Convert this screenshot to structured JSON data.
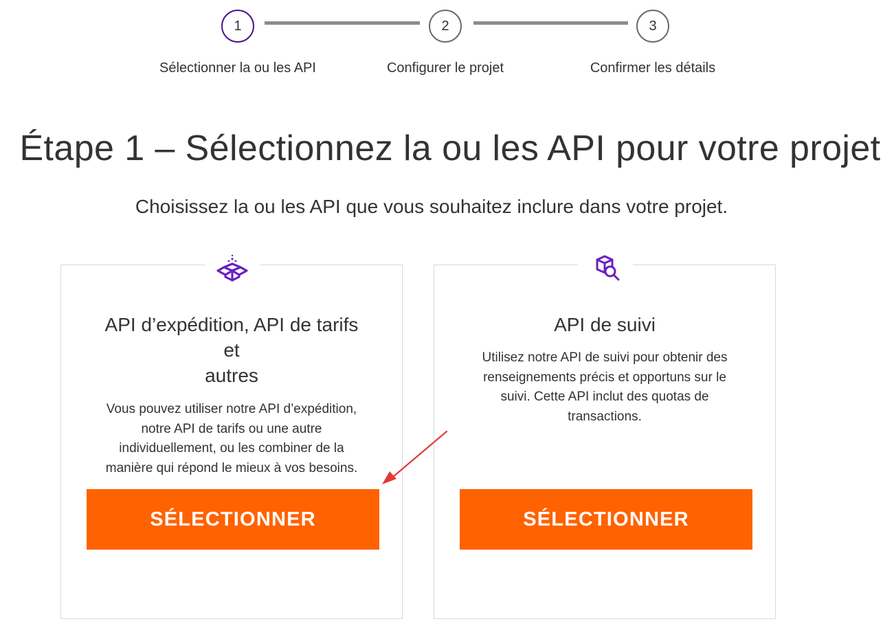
{
  "stepper": {
    "steps": [
      {
        "number": "1",
        "label": "Sélectionner la ou les API",
        "state": "active"
      },
      {
        "number": "2",
        "label": "Configurer le projet",
        "state": "upcoming"
      },
      {
        "number": "3",
        "label": "Confirmer les détails",
        "state": "upcoming"
      }
    ]
  },
  "page": {
    "title": "Étape 1 – Sélectionnez la ou les API pour votre projet",
    "subtitle": "Choisissez la ou les API que vous souhaitez inclure dans votre projet."
  },
  "cards": [
    {
      "icon": "open-box-icon",
      "title_lines": [
        "API d’expédition, API de tarifs",
        "et",
        "autres"
      ],
      "description_lines": [
        "Vous pouvez utiliser notre API d’expédition,",
        "notre API de tarifs ou une autre",
        "individuellement, ou les combiner de la",
        "manière qui répond le mieux à vos besoins."
      ],
      "button_label": "SÉLECTIONNER"
    },
    {
      "icon": "package-search-icon",
      "title_lines": [
        "API de suivi"
      ],
      "description_lines": [
        "Utilisez notre API de suivi pour obtenir des",
        "renseignements précis et opportuns sur le",
        "suivi. Cette API inclut des quotas de",
        "transactions."
      ],
      "button_label": "SÉLECTIONNER"
    }
  ],
  "colors": {
    "accent_purple": "#4d148c",
    "button_orange": "#ff6200",
    "icon_purple": "#6a1fc1",
    "annotation_red": "#e53935"
  }
}
